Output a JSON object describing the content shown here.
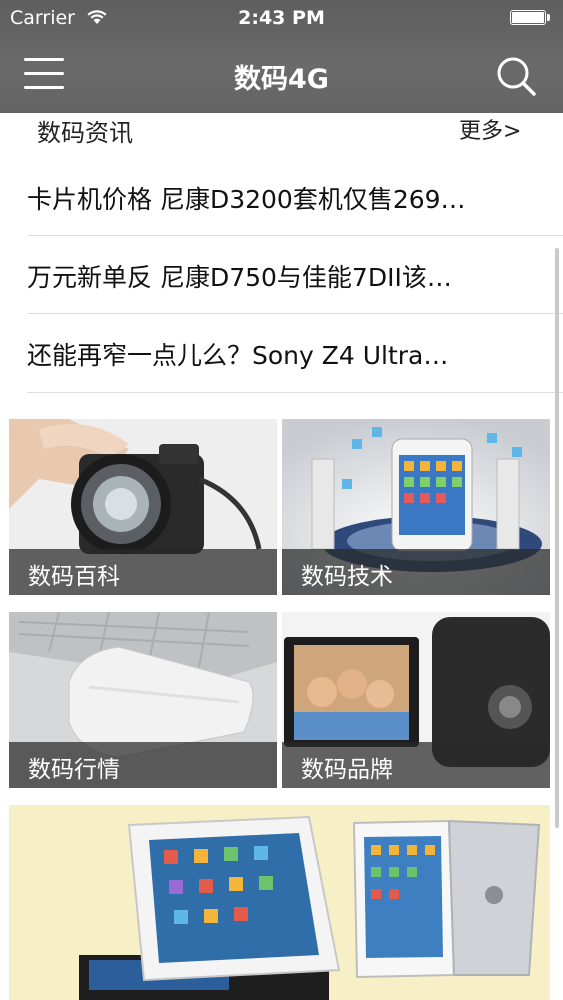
{
  "status_bar": {
    "carrier": "Carrier",
    "time": "2:43 PM"
  },
  "nav": {
    "title": "数码4G"
  },
  "news": {
    "title": "数码资讯",
    "more": "更多>",
    "items": [
      "卡片机价格 尼康D3200套机仅售269…",
      "万元新单反 尼康D750与佳能7DII该…",
      "还能再窄一点儿么？Sony Z4 Ultra…"
    ]
  },
  "tiles": [
    {
      "label": "数码百科"
    },
    {
      "label": "数码技术"
    },
    {
      "label": "数码行情"
    },
    {
      "label": "数码品牌"
    }
  ],
  "icons": {
    "menu": "menu-icon",
    "search": "search-icon",
    "wifi": "wifi-icon",
    "battery": "battery-icon"
  }
}
